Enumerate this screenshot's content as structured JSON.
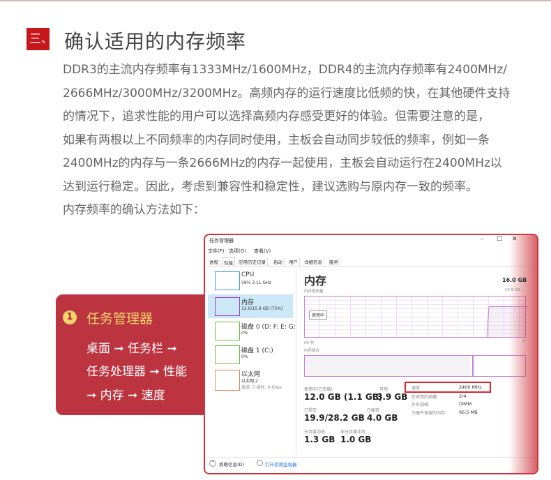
{
  "section": {
    "number": "三、",
    "title": "确认适用的内存频率"
  },
  "paragraph": [
    "DDR3的主流内存频率有1333MHz/1600MHz，DDR4的主流内存频率有2400MHz/",
    "2666MHz/3000MHz/3200MHz。高频内存的运行速度比低频的快，在其他硬件支持",
    "的情况下，追求性能的用户可以选择高频内存感受更好的体验。但需要注意的是，",
    "如果有两根以上不同频率的内存同时使用，主板会自动同步较低的频率，例如一条",
    "2400MHz的内存与一条2666MHz的内存一起使用，主板会自动运行在2400MHz以",
    "达到运行稳定。因此，考虑到兼容性和稳定性，建议选购与原内存一致的频率。",
    "内存频率的确认方法如下："
  ],
  "callout": {
    "number": "1",
    "title": "任务管理器",
    "lines": [
      "桌面 ➞ 任务栏 ➞",
      "任务处理器 ➞ 性能",
      "➞ 内存 ➞ 速度"
    ]
  },
  "taskmanager": {
    "title": "任务管理器",
    "menu": [
      "文件(F)",
      "选项(O)",
      "查看(V)"
    ],
    "tabs": [
      "进程",
      "性能",
      "应用历史记录",
      "启动",
      "用户",
      "详细信息",
      "服务"
    ],
    "window_controls": [
      "–",
      "☐",
      "✕"
    ],
    "sidebar": [
      {
        "name": "CPU",
        "sub": "58% 3.11 GHz",
        "color": "#3c9bd6"
      },
      {
        "name": "内存",
        "sub": "12.0/15.9 GB (75%)",
        "color": "#a33ec7",
        "selected": true
      },
      {
        "name": "磁盘 0 (D: F: E: G:",
        "sub": "0%",
        "color": "#6bbf3c"
      },
      {
        "name": "磁盘 1 (C:)",
        "sub": "0%",
        "color": "#6bbf3c"
      },
      {
        "name": "以太网",
        "sub": "以太网 2",
        "sub2": "发送: 0 接收: 0 Kbps",
        "color": "#d9895a"
      }
    ],
    "main": {
      "heading": "内存",
      "total": "16.0 GB",
      "usage_label": "内存使用量",
      "usage_max": "15.9 GB",
      "in_use_tag": "使用中",
      "time_label": "60 秒",
      "zero": "0",
      "composition_label": "内存组合",
      "stats": [
        {
          "label": "使用中(已压缩)",
          "value": "12.0 GB (1.1 GB)"
        },
        {
          "label": "可用",
          "value": "3.9 GB"
        },
        {
          "label": "已提交",
          "value": "19.9/28.2 GB"
        },
        {
          "label": "已缓存",
          "value": "4.0 GB"
        },
        {
          "label": "分页缓冲池",
          "value": "1.3 GB"
        },
        {
          "label": "非分页缓冲池",
          "value": "1.0 GB"
        }
      ],
      "details": [
        {
          "label": "速度:",
          "value": "2400 MHz"
        },
        {
          "label": "已使用的插槽:",
          "value": "2/4"
        },
        {
          "label": "外形规格:",
          "value": "DIMM"
        },
        {
          "label": "为硬件保留的内存:",
          "value": "66.5 MB"
        }
      ]
    },
    "footer": {
      "less": "简略信息(D)",
      "monitor": "打开资源监视器"
    },
    "colors": {
      "memory": "#a33ec7",
      "highlight": "#e0232a"
    }
  }
}
